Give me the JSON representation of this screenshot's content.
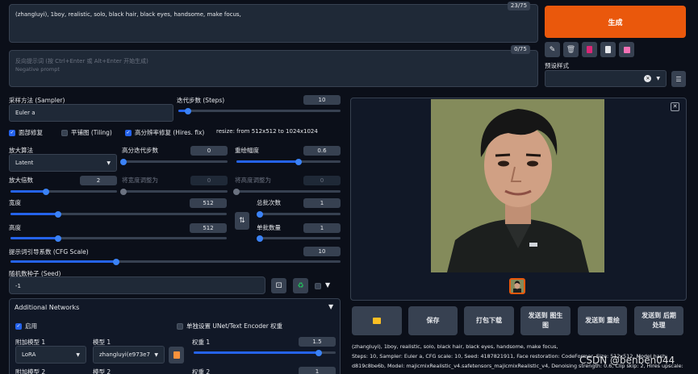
{
  "prompt": {
    "value": "(zhangluyi), 1boy, realistic, solo, black hair, black eyes, handsome, make focus,",
    "counter": "23/75"
  },
  "negative": {
    "placeholder_line1": "反向提示词 (按 Ctrl+Enter 或 Alt+Enter 开始生成)",
    "placeholder_line2": "Negative prompt",
    "counter": "0/75"
  },
  "generate_label": "生成",
  "toolbar": {
    "icons": [
      "pencil-icon",
      "trash-icon",
      "pink-card-icon",
      "clipboard-icon",
      "save-icon"
    ]
  },
  "styles": {
    "label": "预设样式",
    "value": ""
  },
  "sampler": {
    "label": "采样方法 (Sampler)",
    "value": "Euler a"
  },
  "steps": {
    "label": "迭代步数 (Steps)",
    "value": "10",
    "fraction": 0.06
  },
  "checkboxes": {
    "face_restore": {
      "label": "面部修复",
      "checked": true
    },
    "tiling": {
      "label": "平铺图 (Tiling)",
      "checked": false
    },
    "hires": {
      "label": "高分辨率修复 (Hires. fix)",
      "checked": true
    },
    "resize_note": "resize: from 512x512 to 1024x1024"
  },
  "upscaler": {
    "label": "放大算法",
    "value": "Latent"
  },
  "hires_steps": {
    "label": "高分迭代步数",
    "value": "0",
    "fraction": 0.0
  },
  "denoise": {
    "label": "重绘幅度",
    "value": "0.6",
    "fraction": 0.6
  },
  "upscale_by": {
    "label": "放大倍数",
    "value": "2",
    "fraction": 0.33
  },
  "resize_w": {
    "label": "将宽度调整为",
    "value": "0",
    "fraction": 0.0
  },
  "resize_h": {
    "label": "将高度调整为",
    "value": "0",
    "fraction": 0.0
  },
  "width": {
    "label": "宽度",
    "value": "512",
    "fraction": 0.22
  },
  "height": {
    "label": "高度",
    "value": "512",
    "fraction": 0.22
  },
  "swap_icon": "swap-arrows-icon",
  "batch_count": {
    "label": "总批次数",
    "value": "1",
    "fraction": 0.0
  },
  "batch_size": {
    "label": "单批数量",
    "value": "1",
    "fraction": 0.0
  },
  "cfg": {
    "label": "提示词引导系数 (CFG Scale)",
    "value": "10",
    "fraction": 0.32
  },
  "seed": {
    "label": "随机数种子 (Seed)",
    "value": "-1"
  },
  "extra_networks": {
    "title": "Additional Networks",
    "enable_label": "启用",
    "separate_label": "单独设置 UNet/Text Encoder 权重",
    "model1_label": "附加模型 1",
    "model1_type": "LoRA",
    "model1_name_label": "模型 1",
    "model1_name": "zhangluyi(e973e7",
    "weight1_label": "权重 1",
    "weight1_value": "1.5",
    "weight1_fraction": 0.88,
    "model2_label": "附加模型 2",
    "model2_name_label": "模型 2",
    "weight2_label": "权重 2",
    "weight2_value": "1"
  },
  "output": {
    "buttons": [
      {
        "name": "open-folder-button",
        "label": "📁"
      },
      {
        "name": "save-button",
        "label": "保存"
      },
      {
        "name": "zip-button",
        "label": "打包下载"
      },
      {
        "name": "send-img2img-button",
        "label": "发送到 图生图"
      },
      {
        "name": "send-inpaint-button",
        "label": "发送到 重绘"
      },
      {
        "name": "send-extras-button",
        "label": "发送到 后期处理"
      }
    ],
    "info_line1": "(zhangluyi), 1boy, realistic, solo, black hair, black eyes, handsome, make focus,",
    "info_line2": "Steps: 10, Sampler: Euler a, CFG scale: 10, Seed: 4187821911, Face restoration: CodeFormer, Size: 512x512, Model hash:",
    "info_line3": "d819c8be6b, Model: majicmixRealistic_v4.safetensors_majicmixRealistic_v4, Denoising strength: 0.6, Clip skip: 2, Hires upscale:"
  },
  "watermark": "CSDN @benben044",
  "colors": {
    "accent": "#ea580c",
    "slider": "#2563eb",
    "background": "#0b0f19"
  }
}
